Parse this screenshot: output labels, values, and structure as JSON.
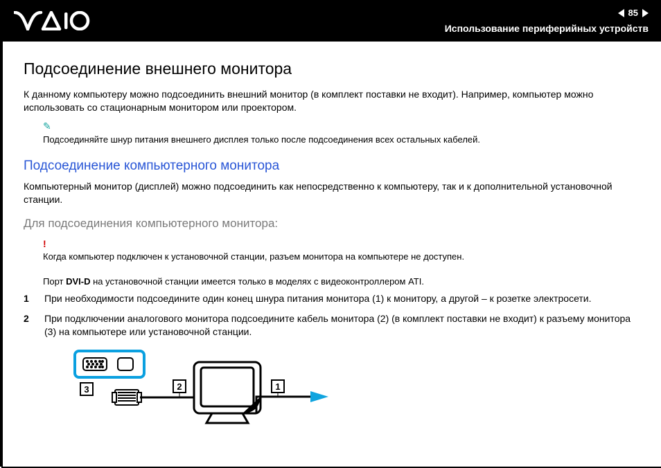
{
  "header": {
    "page_number": "85",
    "section": "Использование периферийных устройств"
  },
  "body": {
    "h1": "Подсоединение внешнего монитора",
    "intro": "К данному компьютеру можно подсоединить внешний монитор (в комплект поставки не входит). Например, компьютер можно использовать со стационарным монитором или проектором.",
    "note1": "Подсоединяйте шнур питания внешнего дисплея только после подсоединения всех остальных кабелей.",
    "h2": "Подсоединение компьютерного монитора",
    "para2": "Компьютерный монитор (дисплей) можно подсоединить как непосредственно к компьютеру, так и к дополнительной установочной станции.",
    "h3": "Для подсоединения компьютерного монитора:",
    "warn1": "Когда компьютер подключен к установочной станции, разъем монитора на компьютере не доступен.",
    "warn2_pre": "Порт ",
    "warn2_bold": "DVI-D",
    "warn2_post": " на установочной станции имеется только в моделях с видеоконтроллером ATI.",
    "step1": "При необходимости подсоедините один конец шнура питания монитора (1) к монитору, а другой – к розетке электросети.",
    "step2": "При подключении аналогового монитора подсоедините кабель монитора (2) (в комплект поставки не входит) к разъему монитора (3) на компьютере или установочной станции.",
    "labels": {
      "l1": "1",
      "l2": "2",
      "l3": "3"
    }
  }
}
